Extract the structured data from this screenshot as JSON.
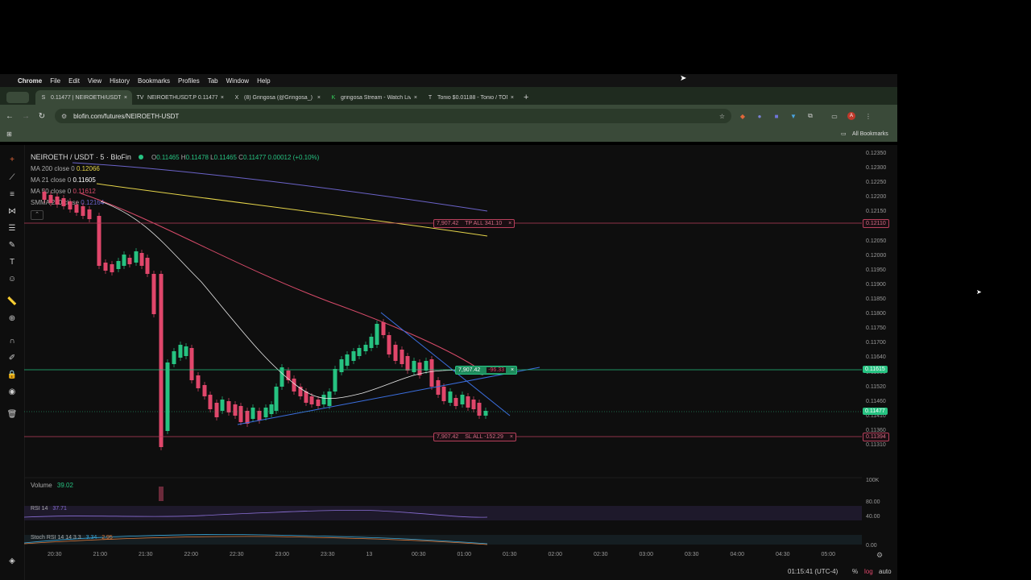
{
  "menubar": {
    "app": "Chrome",
    "items": [
      "File",
      "Edit",
      "View",
      "History",
      "Bookmarks",
      "Profiles",
      "Tab",
      "Window",
      "Help"
    ]
  },
  "tabs": [
    {
      "icon": "S",
      "label": "0.11477 | NEIROETH/USDT | ",
      "active": true
    },
    {
      "icon": "TV",
      "label": "NEIROETHUSDT.P 0.11477 ▼",
      "active": false
    },
    {
      "icon": "X",
      "label": "(8) Gringosa (@Gringosa_) /",
      "active": false
    },
    {
      "icon": "K",
      "label": "gringosa Stream - Watch Live",
      "active": false
    },
    {
      "icon": "T",
      "label": "Tonio $0.01188 - Tonio / TON",
      "active": false
    }
  ],
  "toolbar": {
    "url": "blofin.com/futures/NEIROETH-USDT"
  },
  "bookmarks": {
    "all_label": "All Bookmarks"
  },
  "chart": {
    "symbol": "NEIROETH / USDT · 5 · BloFin",
    "ohlc": {
      "o": "0.11465",
      "h": "0.11478",
      "l": "0.11465",
      "c": "0.11477",
      "chg": "0.00012 (+0.10%)"
    },
    "indicators": [
      {
        "label": "MA 200 close 0",
        "value": "0.12066",
        "color": "#e6d54a"
      },
      {
        "label": "MA 21 close 0",
        "value": "0.11605",
        "color": "#ffffff"
      },
      {
        "label": "MA 50 close 0",
        "value": "0.11612",
        "color": "#d94b6a"
      },
      {
        "label": "SMMA 200 close",
        "value": "0.12164",
        "color": "#6b63c9"
      }
    ],
    "price_axis": [
      "0.12350",
      "0.12300",
      "0.12250",
      "0.12200",
      "0.12150",
      "0.12100",
      "0.12050",
      "0.12000",
      "0.11950",
      "0.11900",
      "0.11850",
      "0.11800",
      "0.11750",
      "0.11700",
      "0.11640",
      "0.11580",
      "0.11520",
      "0.11460",
      "0.11410",
      "0.11360",
      "0.11310"
    ],
    "tp_label": "7,907.42",
    "tp_text": "TP ALL 341.10",
    "tp_price": "0.12110",
    "entry_label": "7,907.42",
    "entry_text": "-96.33",
    "entry_price": "0.11615",
    "current_price": "0.11477",
    "sl_label": "7,907.42",
    "sl_text": "SL ALL -152.29",
    "sl_price": "0.11394",
    "volume_label": "Volume",
    "volume_value": "39.02",
    "volume_axis": "100K",
    "rsi_label": "RSI 14",
    "rsi_value": "37.71",
    "stoch_label": "Stoch RSI 14 14 3 3",
    "stoch_k": "3.34",
    "stoch_d": "2.95",
    "osc_axis": [
      "80.00",
      "40.00",
      "0.00"
    ],
    "time_axis": [
      "20:30",
      "21:00",
      "21:30",
      "22:00",
      "22:30",
      "23:00",
      "23:30",
      "13",
      "00:30",
      "01:00",
      "01:30",
      "02:00",
      "02:30",
      "03:00",
      "03:30",
      "04:00",
      "04:30",
      "05:00"
    ],
    "clock": "01:15:41 (UTC-4)",
    "axis_opts": [
      "%",
      "log",
      "auto"
    ],
    "colors": {
      "up": "#26c281",
      "down": "#e0476b",
      "ma200": "#e6d54a",
      "ma21": "#ffffff",
      "ma50": "#d94b6a",
      "smma": "#6b63c9",
      "trend": "#3b6fe0"
    }
  }
}
